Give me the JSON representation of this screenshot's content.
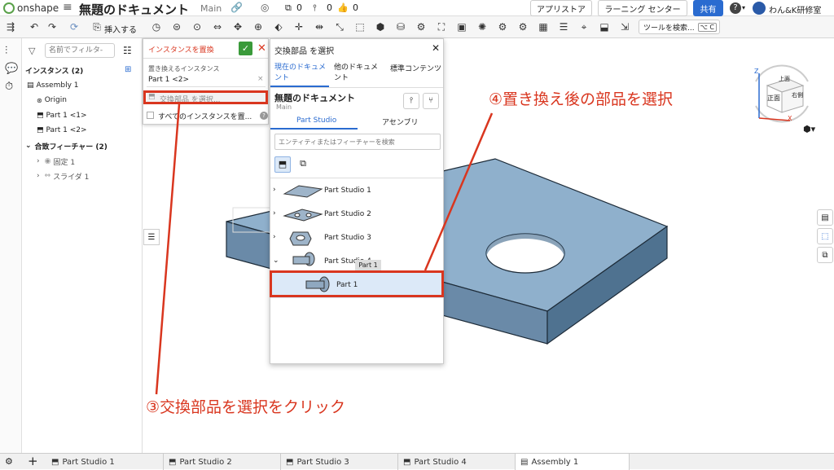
{
  "app": {
    "logo": "onshape",
    "doc_title": "無題のドキュメント",
    "branch": "Main",
    "count_copy": "0",
    "count_pin": "0",
    "count_like": "0"
  },
  "top_right": {
    "app_store": "アプリストア",
    "learning": "ラーニング センター",
    "share": "共有",
    "user": "わん&K研修室",
    "help": "?"
  },
  "toolbar": {
    "insert": "挿入する",
    "tool_search": "ツールを検索...",
    "shortcut": "⌥ C"
  },
  "feature_pane": {
    "filter_placeholder": "名前でフィルタ-",
    "instances_header": "インスタンス (2)",
    "items": [
      "Assembly 1",
      "Origin",
      "Part 1 <1>",
      "Part 1 <2>"
    ],
    "mates_header": "合致フィーチャー (2)",
    "mates": [
      "固定 1",
      "スライダ 1"
    ]
  },
  "replace_dialog": {
    "title": "インスタンスを置換",
    "label": "置き換えるインスタンス",
    "selected": "Part 1 <2>",
    "select_replacement": "交換部品 を選択...",
    "all_instances": "すべてのインスタンスを置..."
  },
  "select_dialog": {
    "title": "交換部品 を選択",
    "tabs": [
      "現在のドキュメント",
      "他のドキュメント",
      "標準コンテンツ"
    ],
    "doc_name": "無題のドキュメント",
    "doc_branch": "Main",
    "subtabs": [
      "Part Studio",
      "アセンブリ"
    ],
    "search_placeholder": "エンティティまたはフィーチャーを検索",
    "studios": [
      "Part Studio 1",
      "Part Studio 2",
      "Part Studio 3",
      "Part Studio 4"
    ],
    "tooltip": "Part 1",
    "part": "Part 1"
  },
  "annotations": {
    "step3": "③交換部品を選択をクリック",
    "step4": "④置き換え後の部品を選択"
  },
  "viewcube": {
    "top": "上面",
    "front": "正面",
    "right": "右側",
    "z": "Z",
    "x": "X"
  },
  "tabs": [
    "Part Studio 1",
    "Part Studio 2",
    "Part Studio 3",
    "Part Studio 4",
    "Assembly 1"
  ],
  "colors": {
    "accent": "#2a6bd0",
    "annotation": "#d9361f",
    "part_top": "#8fb0cc",
    "part_side": "#5b7fa0",
    "confirm": "#3a9a3a"
  }
}
